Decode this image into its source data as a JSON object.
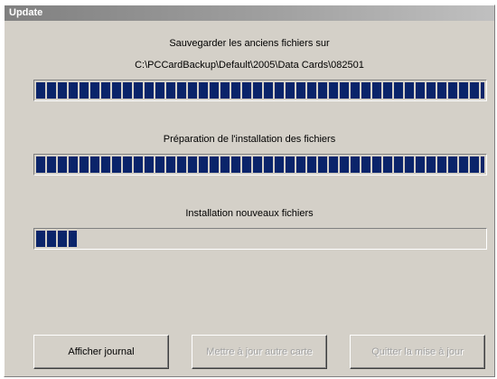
{
  "window": {
    "title": "Update"
  },
  "backup": {
    "label": "Sauvegarder les anciens fichiers sur",
    "path": "C:\\PCCardBackup\\Default\\2005\\Data Cards\\082501",
    "progress": 1.0
  },
  "preparation": {
    "label": "Préparation de l'installation des fichiers",
    "progress": 1.0
  },
  "install": {
    "label": "Installation nouveaux fichiers",
    "progress": 0.09
  },
  "buttons": {
    "show_log": "Afficher journal",
    "update_other_card": "Mettre à jour autre carte",
    "quit_update": "Quitter la mise à jour"
  },
  "colors": {
    "progress_fill": "#0a246a",
    "window_bg": "#d4d0c8"
  }
}
